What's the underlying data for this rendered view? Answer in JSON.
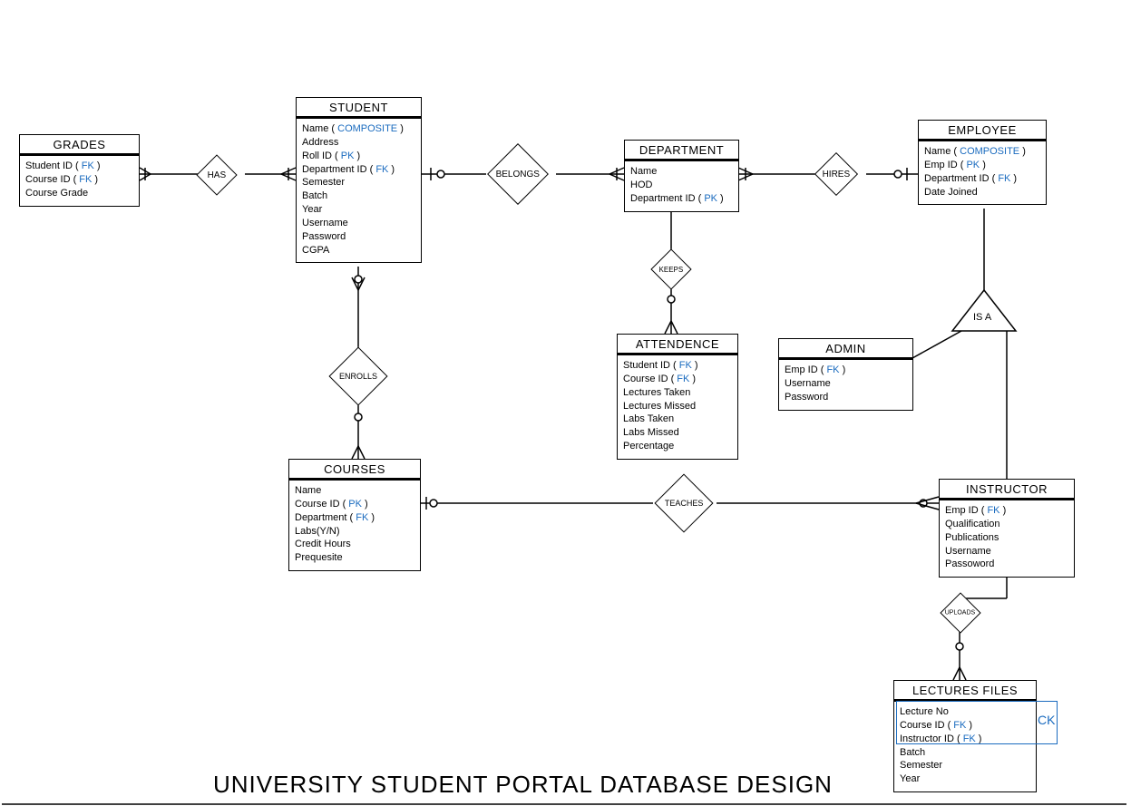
{
  "title": "UNIVERSITY STUDENT PORTAL DATABASE DESIGN",
  "keyColor": "#1a6bbf",
  "entities": {
    "grades": {
      "title": "GRADES",
      "attrs": [
        {
          "text": "Student ID ( ",
          "key": "FK",
          "after": " )"
        },
        {
          "text": "Course ID ( ",
          "key": "FK",
          "after": " )"
        },
        {
          "text": "Course Grade"
        }
      ]
    },
    "student": {
      "title": "STUDENT",
      "attrs": [
        {
          "text": "Name ( ",
          "key": "COMPOSITE",
          "after": " )"
        },
        {
          "text": "Address"
        },
        {
          "text": "Roll ID ( ",
          "key": "PK",
          "after": " )"
        },
        {
          "text": "Department ID ( ",
          "key": "FK",
          "after": " )"
        },
        {
          "text": "Semester"
        },
        {
          "text": "Batch"
        },
        {
          "text": "Year"
        },
        {
          "text": "Username"
        },
        {
          "text": "Password"
        },
        {
          "text": "CGPA"
        }
      ]
    },
    "department": {
      "title": "DEPARTMENT",
      "attrs": [
        {
          "text": "Name"
        },
        {
          "text": "HOD"
        },
        {
          "text": "Department ID ( ",
          "key": "PK",
          "after": " )"
        }
      ]
    },
    "employee": {
      "title": "EMPLOYEE",
      "attrs": [
        {
          "text": "Name ( ",
          "key": "COMPOSITE",
          "after": " )"
        },
        {
          "text": "Emp ID ( ",
          "key": "PK",
          "after": " )"
        },
        {
          "text": "Department ID ( ",
          "key": "FK",
          "after": " )"
        },
        {
          "text": "Date Joined"
        }
      ]
    },
    "attendence": {
      "title": "ATTENDENCE",
      "attrs": [
        {
          "text": "Student ID ( ",
          "key": "FK",
          "after": " )"
        },
        {
          "text": "Course ID ( ",
          "key": "FK",
          "after": " )"
        },
        {
          "text": "Lectures Taken"
        },
        {
          "text": "Lectures Missed"
        },
        {
          "text": "Labs Taken"
        },
        {
          "text": "Labs Missed"
        },
        {
          "text": "Percentage"
        }
      ]
    },
    "admin": {
      "title": "ADMIN",
      "attrs": [
        {
          "text": "Emp ID ( ",
          "key": "FK",
          "after": " )"
        },
        {
          "text": "Username"
        },
        {
          "text": "Password"
        }
      ]
    },
    "courses": {
      "title": "COURSES",
      "attrs": [
        {
          "text": "Name"
        },
        {
          "text": "Course ID ( ",
          "key": "PK",
          "after": " )"
        },
        {
          "text": "Department ( ",
          "key": "FK",
          "after": " )"
        },
        {
          "text": "Labs(Y/N)"
        },
        {
          "text": "Credit Hours"
        },
        {
          "text": "Prequesite"
        }
      ]
    },
    "instructor": {
      "title": "INSTRUCTOR",
      "attrs": [
        {
          "text": "Emp ID ( ",
          "key": "FK",
          "after": " )"
        },
        {
          "text": "Qualification"
        },
        {
          "text": "Publications"
        },
        {
          "text": "Username"
        },
        {
          "text": "Passoword"
        }
      ]
    },
    "lectures": {
      "title": "LECTURES FILES",
      "attrs": [
        {
          "text": "Lecture No"
        },
        {
          "text": "Course ID ( ",
          "key": "FK",
          "after": " )"
        },
        {
          "text": "Instructor ID ( ",
          "key": "FK",
          "after": " )"
        },
        {
          "text": "Batch"
        },
        {
          "text": "Semester"
        },
        {
          "text": "Year"
        }
      ]
    }
  },
  "relationships": {
    "has": "HAS",
    "belongs": "BELONGS",
    "hires": "HIRES",
    "keeps": "KEEPS",
    "enrolls": "ENROLLS",
    "teaches": "TEACHES",
    "uploads": "UPLOADS",
    "isa": "IS A"
  },
  "ck": "CK"
}
